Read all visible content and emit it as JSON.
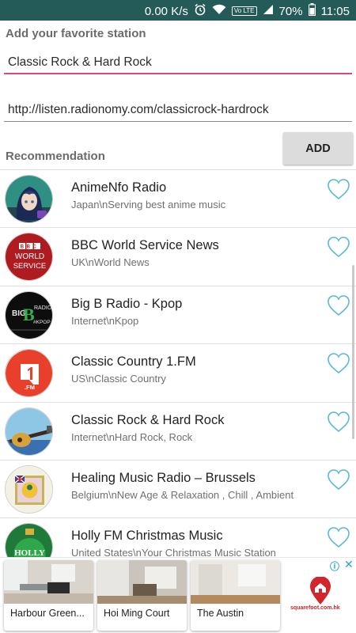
{
  "status_bar": {
    "speed": "0.00 K/s",
    "volte": "Vo LTE",
    "battery": "70%",
    "time": "11:05",
    "icons": [
      "alarm-icon",
      "wifi-icon",
      "signal-icon",
      "battery-icon"
    ]
  },
  "form": {
    "title": "Add your favorite station",
    "name_value": "Classic Rock & Hard Rock",
    "url_value": "http://listen.radionomy.com/classicrock-hardrock",
    "add_label": "ADD"
  },
  "recommendation": {
    "title": "Recommendation",
    "stations": [
      {
        "name": "AnimeNfo Radio",
        "desc": "Japan\\nServing best anime music",
        "favorite": false
      },
      {
        "name": "BBC World Service News",
        "desc": "UK\\nWorld News",
        "favorite": false
      },
      {
        "name": "Big B Radio - Kpop",
        "desc": "Internet\\nKpop",
        "favorite": false
      },
      {
        "name": "Classic Country 1.FM",
        "desc": "US\\nClassic Country",
        "favorite": false
      },
      {
        "name": "Classic Rock & Hard Rock",
        "desc": "Internet\\nHard Rock, Rock",
        "favorite": false
      },
      {
        "name": "Healing Music Radio – Brussels",
        "desc": "Belgium\\nNew Age & Relaxation , Chill , Ambient",
        "favorite": false
      },
      {
        "name": "Holly FM Christmas Music",
        "desc": "United States\\nYour Christmas Music Station",
        "favorite": false
      }
    ],
    "logo_text": {
      "bbc": [
        "BBC",
        "WORLD",
        "SERVICE"
      ],
      "bigb": [
        "BIG",
        "RADIO",
        "#KPOP"
      ],
      "fm1": [
        ".FM"
      ],
      "holly": [
        "HOLLY"
      ]
    }
  },
  "ad": {
    "cards": [
      {
        "caption": "Harbour Green..."
      },
      {
        "caption": "Hoi Ming Court"
      },
      {
        "caption": "The Austin"
      }
    ],
    "brand": "squarefoot.com.hk",
    "info_icon": "ⓘ",
    "close_icon": "✕"
  },
  "colors": {
    "status_bar": "#245b59",
    "accent_underline": "#e0457b",
    "heart": "#5ab8d8",
    "ad_link": "#20a4c8"
  }
}
